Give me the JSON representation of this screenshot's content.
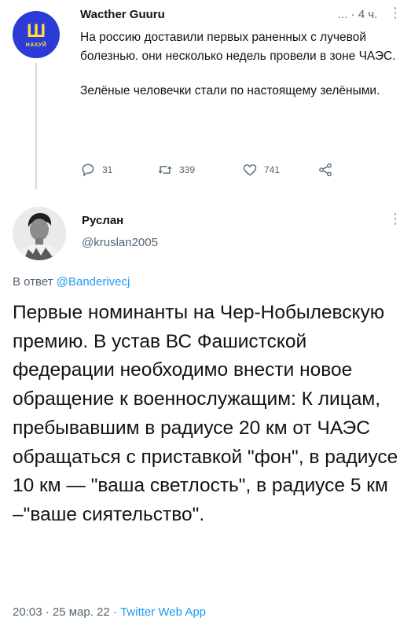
{
  "first_tweet": {
    "avatar_text": "НАХУЙ",
    "author_name": "Wacther Guuru",
    "time": "... · 4 ч.",
    "more": "⋮",
    "paragraphs": [
      "На россию доставили первых раненных с лучевой болезнью. они несколько недель провели в зоне ЧАЭС.",
      "Зелёные человечки стали по настоящему зелёными."
    ],
    "actions": {
      "reply_count": "31",
      "retweet_count": "339",
      "like_count": "741"
    }
  },
  "second_tweet": {
    "author_name": "Руслан",
    "author_handle": "@kruslan2005",
    "more": "⋮",
    "reply_prefix": "В ответ ",
    "reply_mention": "@Banderivecj",
    "text": "Первые номинанты на Чер-Нобылевскую премию. В устав ВС Фашистской федерации необходимо внести новое обращение к военнослужащим: К лицам, пребывавшим в радиусе 20 км от ЧАЭС обращаться с приставкой \"фон\", в радиусе 10 км — \"ваша светлость\", в радиусе 5 км –\"ваше сиятельство\".",
    "timestamp": "20:03 · 25 мар. 22 · ",
    "source": "Twitter Web App"
  },
  "colors": {
    "accent": "#1d9bf0",
    "muted": "#536471",
    "avatar_bg": "#2c3bd6",
    "avatar_fg": "#ffe13a"
  }
}
